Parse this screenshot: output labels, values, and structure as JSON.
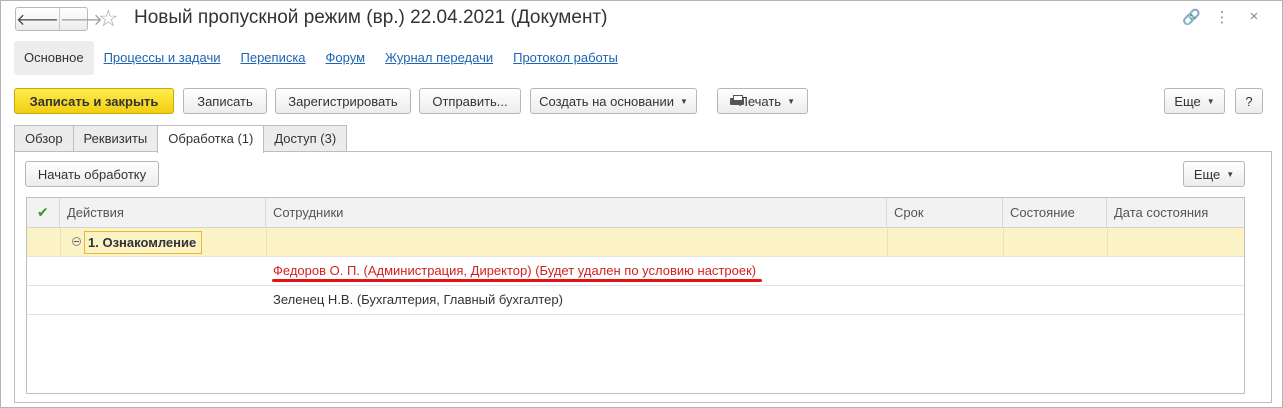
{
  "window": {
    "title": "Новый пропускной режим (вр.) 22.04.2021 (Документ)",
    "nav_back": "🡐",
    "nav_forward": "🡒",
    "star": "☆",
    "icons": [
      "link-icon",
      "more-vertical-icon",
      "close-icon"
    ],
    "link_glyph": "🔗",
    "more_glyph": "⋮",
    "close_glyph": "×"
  },
  "sections": [
    {
      "label": "Основное",
      "active": true
    },
    {
      "label": "Процессы и задачи"
    },
    {
      "label": "Переписка"
    },
    {
      "label": "Форум"
    },
    {
      "label": "Журнал передачи"
    },
    {
      "label": "Протокол работы"
    }
  ],
  "toolbar": {
    "save_close": "Записать и закрыть",
    "save": "Записать",
    "register": "Зарегистрировать",
    "send": "Отправить...",
    "create_based": "Создать на основании",
    "print": "Печать",
    "more": "Еще",
    "help": "?"
  },
  "tabs": [
    {
      "label": "Обзор"
    },
    {
      "label": "Реквизиты"
    },
    {
      "label": "Обработка (1)",
      "active": true
    },
    {
      "label": "Доступ (3)"
    }
  ],
  "panel": {
    "start_processing": "Начать обработку",
    "more": "Еще"
  },
  "grid": {
    "columns": [
      "Действия",
      "Сотрудники",
      "Срок",
      "Состояние",
      "Дата состояния"
    ],
    "check_glyph": "✔",
    "group": {
      "label": "1. Ознакомление"
    },
    "rows": [
      {
        "employee": "Федоров О. П. (Администрация, Директор) (Будет удален по условию настроек)",
        "highlight": true
      },
      {
        "employee": "Зеленец Н.В. (Бухгалтерия, Главный бухгалтер)"
      }
    ]
  },
  "colors": {
    "accent_yellow": "#f5d31a",
    "link_blue": "#1e64b4",
    "warning_red": "#d21f1f",
    "group_bg": "#fbf2c5"
  }
}
